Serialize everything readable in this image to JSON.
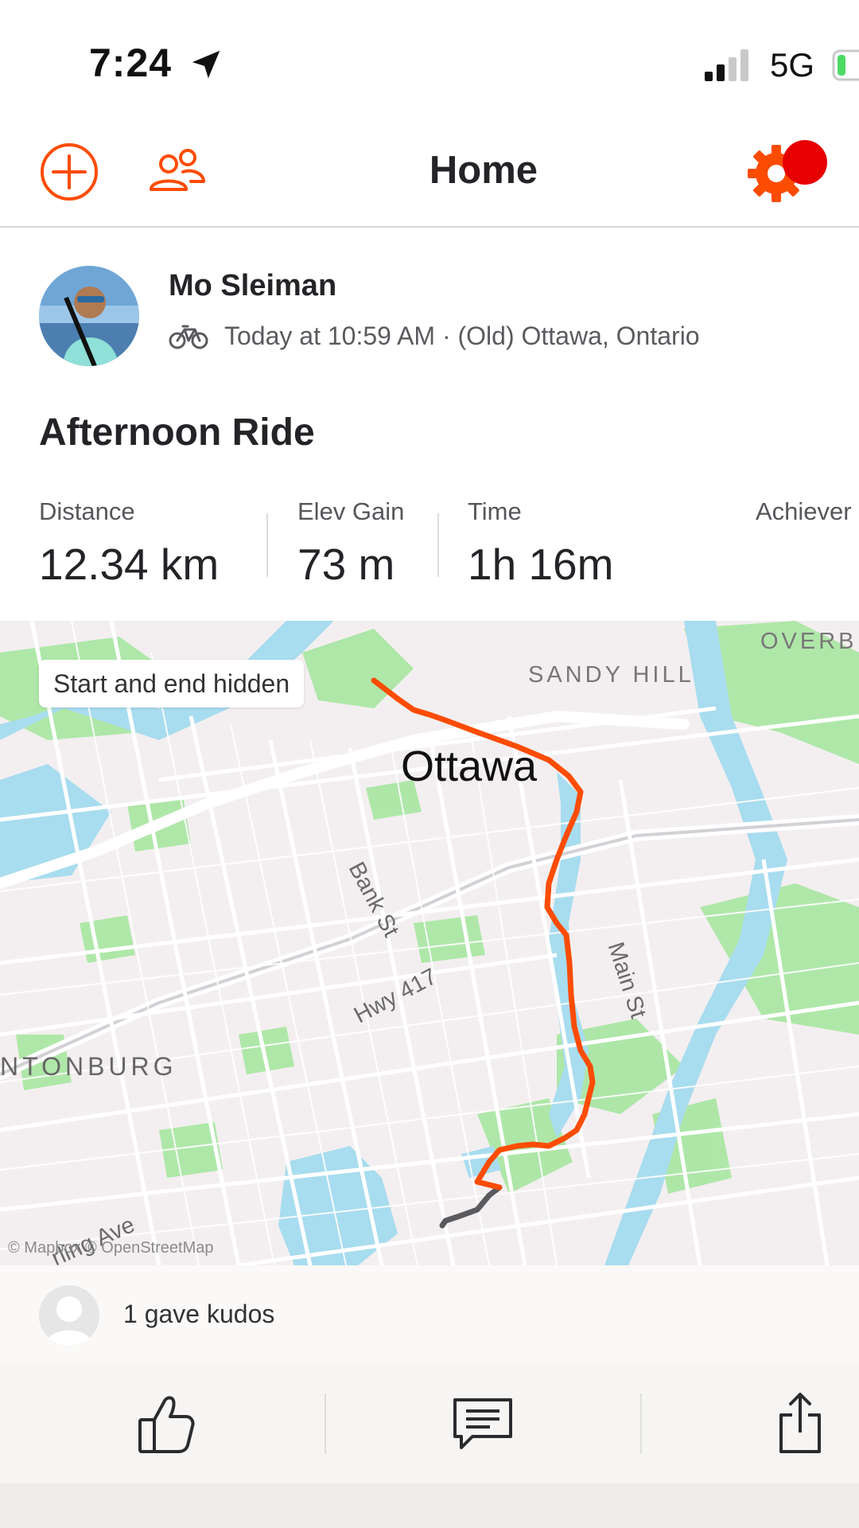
{
  "status_bar": {
    "time": "7:24",
    "network": "5G"
  },
  "header": {
    "title": "Home"
  },
  "activity": {
    "athlete_name": "Mo Sleiman",
    "meta": "Today at 10:59 AM · (Old) Ottawa, Ontario",
    "title": "Afternoon Ride",
    "stats": [
      {
        "label": "Distance",
        "value": "12.34 km"
      },
      {
        "label": "Elev Gain",
        "value": "73 m"
      },
      {
        "label": "Time",
        "value": "1h 16m"
      },
      {
        "label": "Achiever",
        "value": ""
      }
    ]
  },
  "map": {
    "chip": "Start and end hidden",
    "city": "Ottawa",
    "labels": {
      "sandy_hill": "SANDY HILL",
      "overbrook": "OVERBI",
      "mechanicsville": "NTONBURG",
      "bank_st": "Bank St",
      "main_st": "Main St",
      "hwy": "Hwy 417",
      "carling": "rling Ave",
      "attribution": "© Mapbox © OpenStreetMap"
    },
    "colors": {
      "water": "#a8dcef",
      "park": "#a7e6a1",
      "route": "#fc4c02",
      "route_hidden": "#5a5a5f"
    }
  },
  "kudos": {
    "text": "1 gave kudos"
  },
  "colors": {
    "brand": "#fc4c02",
    "notification": "#e60000"
  },
  "icons": {
    "add": "plus-circle-icon",
    "friends": "people-icon",
    "settings": "gear-icon",
    "kudos": "thumbs-up-icon",
    "comment": "comment-icon",
    "share": "share-icon",
    "sport": "bike-icon"
  }
}
